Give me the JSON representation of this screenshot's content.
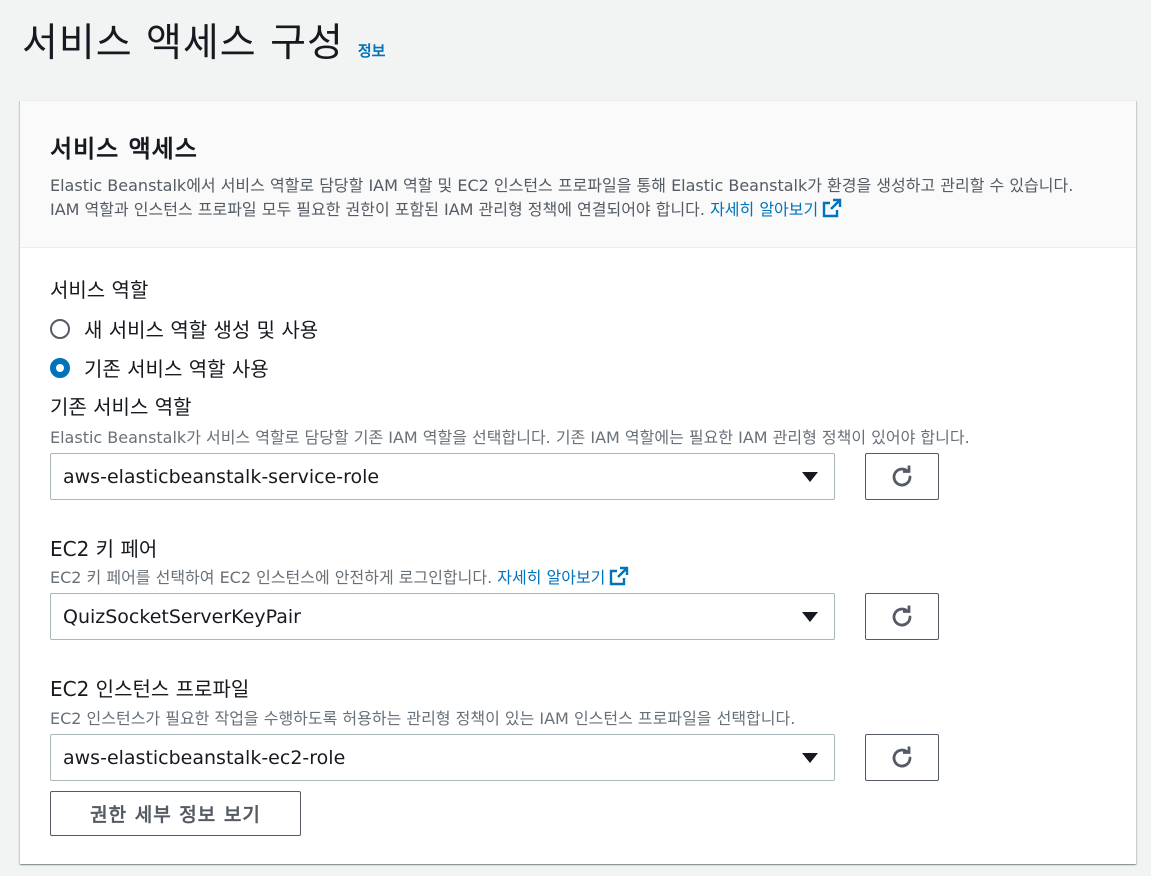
{
  "header": {
    "title": "서비스 액세스 구성",
    "info_link": "정보"
  },
  "section": {
    "title": "서비스 액세스",
    "description": "Elastic Beanstalk에서 서비스 역할로 담당할 IAM 역할 및 EC2 인스턴스 프로파일을 통해 Elastic Beanstalk가 환경을 생성하고 관리할 수 있습니다. IAM 역할과 인스턴스 프로파일 모두 필요한 권한이 포함된 IAM 관리형 정책에 연결되어야 합니다.",
    "learn_more": "자세히 알아보기"
  },
  "service_role": {
    "label": "서비스 역할",
    "options": [
      {
        "label": "새 서비스 역할 생성 및 사용",
        "checked": false
      },
      {
        "label": "기존 서비스 역할 사용",
        "checked": true
      }
    ]
  },
  "existing_role": {
    "label": "기존 서비스 역할",
    "description": "Elastic Beanstalk가 서비스 역할로 담당할 기존 IAM 역할을 선택합니다. 기존 IAM 역할에는 필요한 IAM 관리형 정책이 있어야 합니다.",
    "value": "aws-elasticbeanstalk-service-role"
  },
  "key_pair": {
    "label": "EC2 키 페어",
    "description": "EC2 키 페어를 선택하여 EC2 인스턴스에 안전하게 로그인합니다.",
    "learn_more": "자세히 알아보기",
    "value": "QuizSocketServerKeyPair"
  },
  "instance_profile": {
    "label": "EC2 인스턴스 프로파일",
    "description": "EC2 인스턴스가 필요한 작업을 수행하도록 허용하는 관리형 정책이 있는 IAM 인스턴스 프로파일을 선택합니다.",
    "value": "aws-elasticbeanstalk-ec2-role"
  },
  "view_permissions_button": "권한 세부 정보 보기",
  "colors": {
    "link": "#0073bb",
    "radio_checked": "#0073bb",
    "text": "#16191f",
    "muted": "#687078"
  },
  "icons": {
    "external_link": "external-link-icon",
    "refresh": "refresh-icon",
    "caret": "caret-down-icon"
  }
}
